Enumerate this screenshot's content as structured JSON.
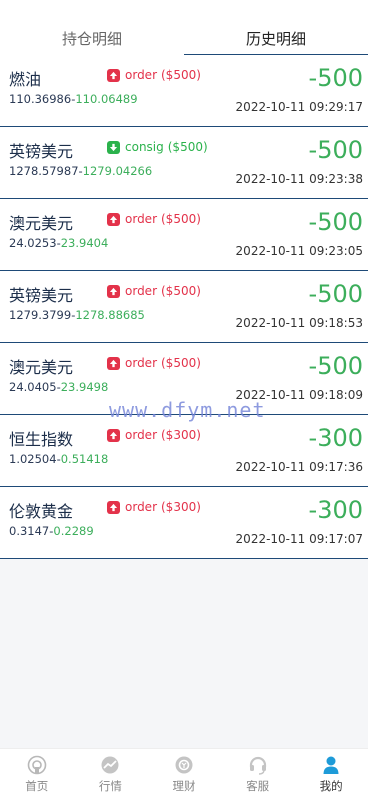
{
  "tabs": [
    {
      "label": "持仓明细",
      "active": false
    },
    {
      "label": "历史明细",
      "active": true
    }
  ],
  "records": [
    {
      "name": "燃油",
      "direction": "up",
      "type": "order",
      "stake": "($500)",
      "open": "110.36986",
      "close": "110.06489",
      "amount": "-500",
      "time": "2022-10-11 09:29:17"
    },
    {
      "name": "英镑美元",
      "direction": "down",
      "type": "consig",
      "stake": "($500)",
      "open": "1278.57987",
      "close": "1279.04266",
      "amount": "-500",
      "time": "2022-10-11 09:23:38"
    },
    {
      "name": "澳元美元",
      "direction": "up",
      "type": "order",
      "stake": "($500)",
      "open": "24.0253",
      "close": "23.9404",
      "amount": "-500",
      "time": "2022-10-11 09:23:05"
    },
    {
      "name": "英镑美元",
      "direction": "up",
      "type": "order",
      "stake": "($500)",
      "open": "1279.3799",
      "close": "1278.88685",
      "amount": "-500",
      "time": "2022-10-11 09:18:53"
    },
    {
      "name": "澳元美元",
      "direction": "up",
      "type": "order",
      "stake": "($500)",
      "open": "24.0405",
      "close": "23.9498",
      "amount": "-500",
      "time": "2022-10-11 09:18:09"
    },
    {
      "name": "恒生指数",
      "direction": "up",
      "type": "order",
      "stake": "($300)",
      "open": "1.02504",
      "close": "0.51418",
      "amount": "-300",
      "time": "2022-10-11 09:17:36"
    },
    {
      "name": "伦敦黄金",
      "direction": "up",
      "type": "order",
      "stake": "($300)",
      "open": "0.3147",
      "close": "0.2289",
      "amount": "-300",
      "time": "2022-10-11 09:17:07"
    }
  ],
  "watermark": "www.dfym.net",
  "nav": [
    {
      "label": "首页",
      "icon": "home-icon",
      "active": false
    },
    {
      "label": "行情",
      "icon": "chart-icon",
      "active": false
    },
    {
      "label": "理财",
      "icon": "finance-icon",
      "active": false
    },
    {
      "label": "客服",
      "icon": "headset-icon",
      "active": false
    },
    {
      "label": "我的",
      "icon": "user-icon",
      "active": true
    }
  ],
  "colors": {
    "accent": "#1e4a78",
    "profit_green": "#3cae5b",
    "up_red": "#e3324a",
    "down_green": "#2bb24c",
    "nav_active": "#1e9bd8"
  }
}
